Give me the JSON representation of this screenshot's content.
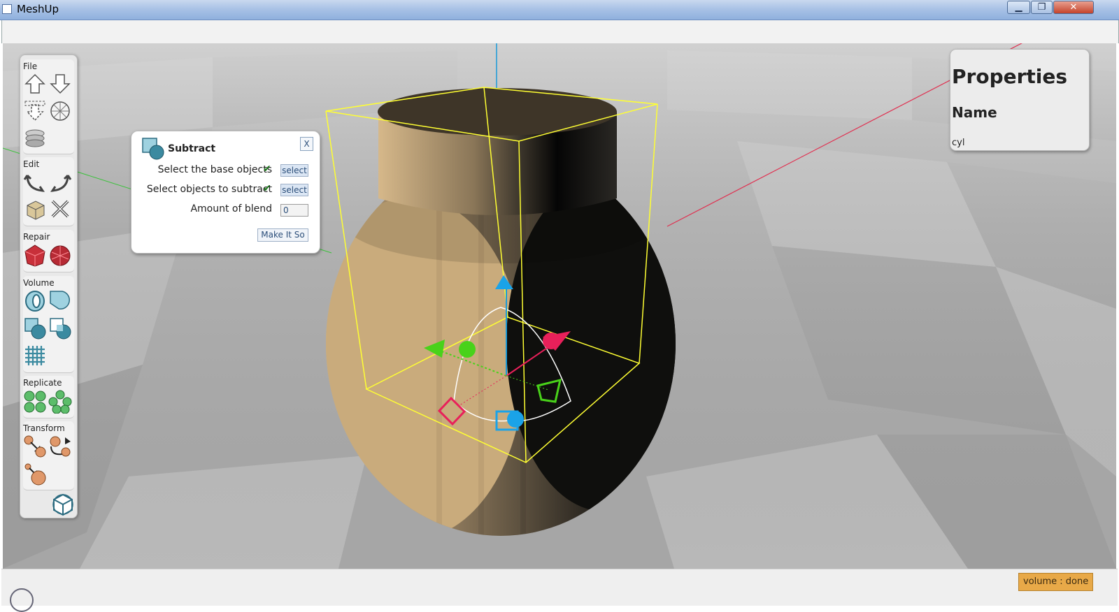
{
  "window": {
    "title": "MeshUp",
    "minimize": "▁",
    "maximize": "❐",
    "close": "✕"
  },
  "palette": {
    "sections": [
      {
        "label": "File",
        "tools": [
          "import-up-icon",
          "export-down-icon",
          "save-selection-icon",
          "sphere-mesh-icon",
          "stack-icon"
        ]
      },
      {
        "label": "Edit",
        "tools": [
          "undo-icon",
          "redo-icon",
          "duplicate-cube-icon",
          "delete-x-icon"
        ]
      },
      {
        "label": "Repair",
        "tools": [
          "repair-mesh-icon",
          "repair-mesh-alt-icon"
        ]
      },
      {
        "label": "Volume",
        "tools": [
          "hollow-icon",
          "union-icon",
          "subtract-icon",
          "intersect-icon",
          "lattice-icon"
        ]
      },
      {
        "label": "Replicate",
        "tools": [
          "replicate-grid-icon",
          "replicate-cluster-icon"
        ]
      },
      {
        "label": "Transform",
        "tools": [
          "move-icon",
          "rotate-icon",
          "scale-icon"
        ]
      }
    ],
    "bottom_icon": "view-cube-icon"
  },
  "dialog": {
    "title": "Subtract",
    "close_label": "X",
    "rows": [
      {
        "label": "Select the base objects",
        "check": "✔",
        "button": "select"
      },
      {
        "label": "Select objects to subtract",
        "check": "✔",
        "button": "select"
      }
    ],
    "blend_label": "Amount of blend",
    "blend_value": "0",
    "action_label": "Make It So"
  },
  "properties": {
    "title": "Properties",
    "field_label": "Name",
    "field_value": "cyl"
  },
  "status": {
    "badge": "volume : done"
  },
  "colors": {
    "ground": "#a9a9a9",
    "bbox": "#ffff33",
    "x_axis": "#e8205a",
    "y_axis": "#49d21a",
    "z_axis": "#1aa3e8",
    "mesh_light": "#c8a97b",
    "mesh_dark": "#1b1a15",
    "status_badge": "#e8a948"
  }
}
